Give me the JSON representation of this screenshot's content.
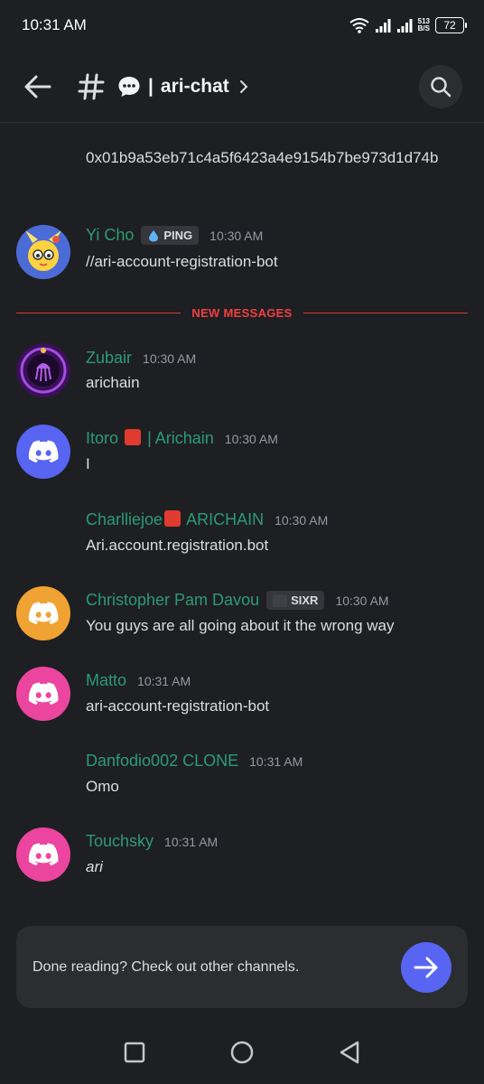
{
  "status": {
    "time": "10:31 AM",
    "net_speed_top": "513",
    "net_speed_bottom": "B/S",
    "battery": "72"
  },
  "header": {
    "separator": "|",
    "channel_name": "ari-chat"
  },
  "continuation": {
    "text": "0x01b9a53eb71c4a5f6423a4e9154b7be973d1d74b"
  },
  "divider_label": "NEW MESSAGES",
  "messages": [
    {
      "author": "Yi Cho",
      "tag": "PING",
      "time": "10:30 AM",
      "text": "//ari-account-registration-bot"
    },
    {
      "author": "Zubair",
      "time": "10:30 AM",
      "text": "arichain"
    },
    {
      "author_prefix": "Itoro",
      "author_suffix": "| Arichain",
      "time": "10:30 AM",
      "text": "I"
    },
    {
      "author_prefix": "Charlliejoe",
      "author_suffix": "ARICHAIN",
      "time": "10:30 AM",
      "text": "Ari.account.registration.bot"
    },
    {
      "author": "Christopher Pam Davou",
      "tag": "SIXR",
      "time": "10:30 AM",
      "text": "You guys are all going about it the wrong way"
    },
    {
      "author": "Matto",
      "time": "10:31 AM",
      "text": "ari-account-registration-bot"
    },
    {
      "author": "Danfodio002 CLONE",
      "time": "10:31 AM",
      "text": "Omo"
    },
    {
      "author": "Touchsky",
      "time": "10:31 AM",
      "text": "ari"
    }
  ],
  "colors": {
    "background": "#1e1f22",
    "author": "#2b9c73",
    "divider": "#f23f43",
    "blurple": "#5865f2",
    "avatar_orange": "#f0a232",
    "avatar_pink": "#eb459f"
  },
  "prompt": {
    "text": "Done reading? Check out other channels."
  }
}
